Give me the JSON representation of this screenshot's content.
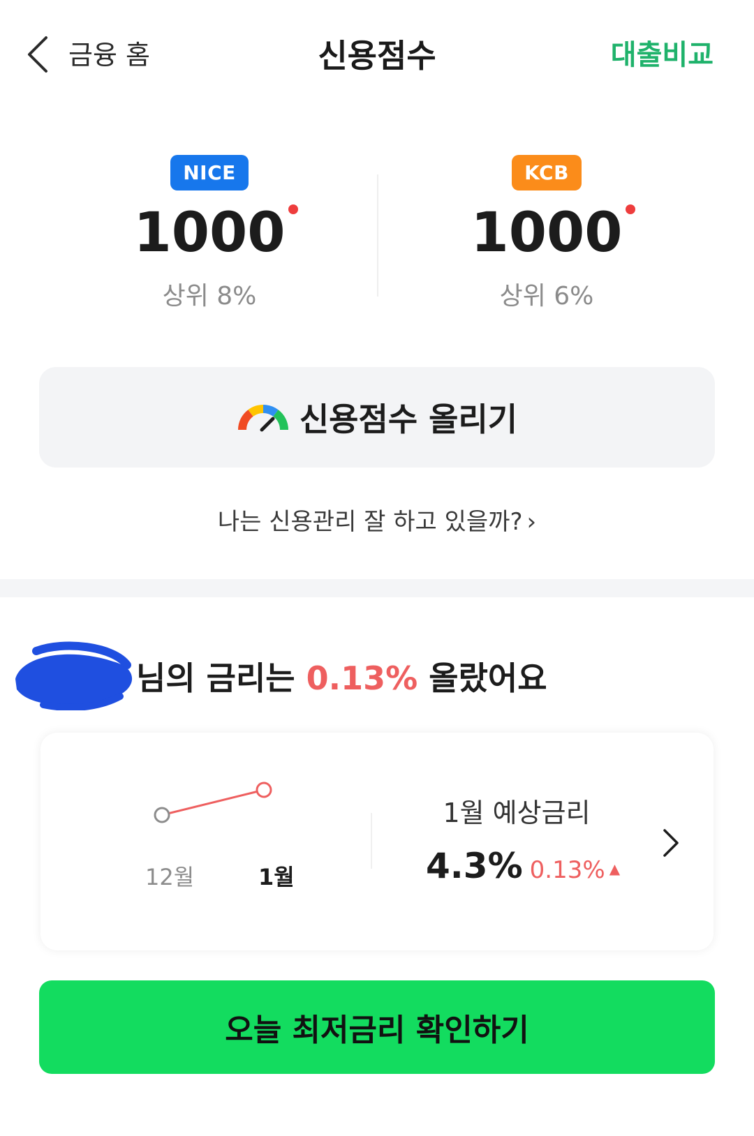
{
  "header": {
    "back_label": "금융 홈",
    "title": "신용점수",
    "loan_compare": "대출비교"
  },
  "scores": [
    {
      "bureau": "NICE",
      "score": "1000",
      "rank": "상위 8%",
      "color": "#1777ec"
    },
    {
      "bureau": "KCB",
      "score": "1000",
      "rank": "상위 6%",
      "color": "#fb8c1a"
    }
  ],
  "raise_button": {
    "label": "신용점수 올리기",
    "icon": "gauge-icon"
  },
  "manage_link": {
    "label": "나는 신용관리 잘 하고 있을까?",
    "chevron": "›"
  },
  "rate_section": {
    "headline_prefix": "님의 금리는 ",
    "headline_rate": "0.13%",
    "headline_suffix": " 올랐어요",
    "months": [
      {
        "label": "12월",
        "rate": 4.17
      },
      {
        "label": "1월",
        "rate": 4.3
      }
    ],
    "forecast_label": "1월 예상금리",
    "forecast_rate": "4.3%",
    "forecast_change": "0.13%",
    "change_direction_icon": "up-caret-icon"
  },
  "cta": {
    "label": "오늘 최저금리 확인하기"
  },
  "colors": {
    "accent_green": "#1fb26b",
    "cta_green": "#13dc5f",
    "rise_red": "#ee5f5f"
  }
}
